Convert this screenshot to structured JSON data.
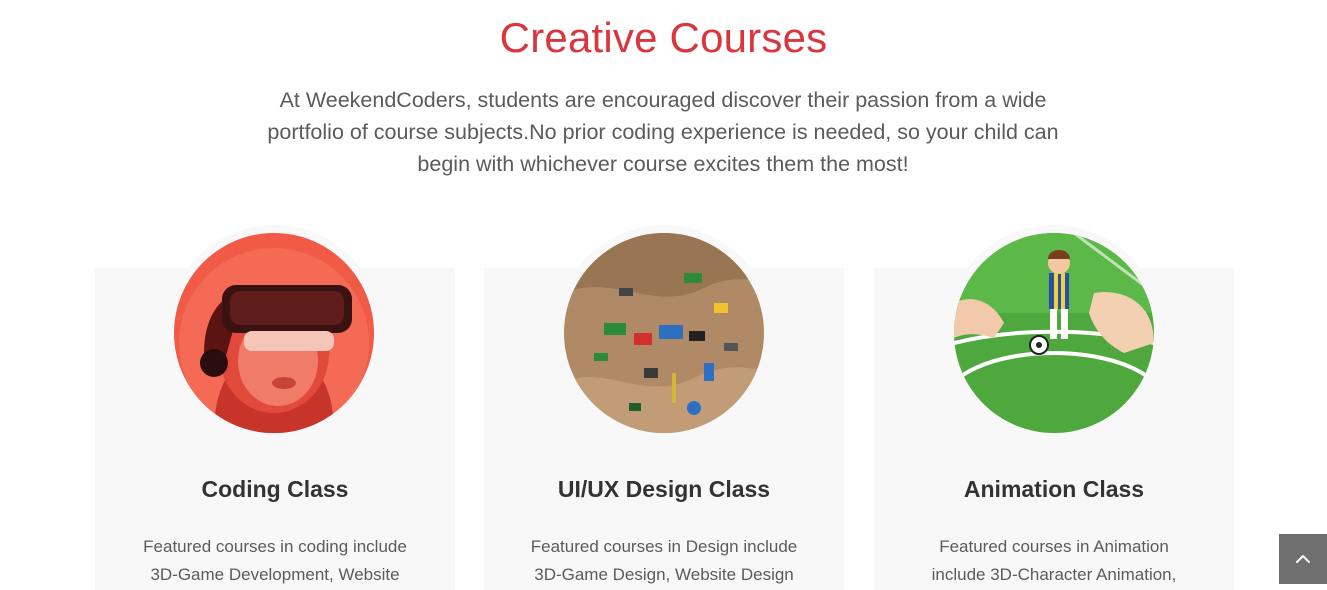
{
  "section": {
    "title": "Creative Courses",
    "intro": "At WeekendCoders, students are encouraged discover their passion from a wide portfolio of course subjects.No prior coding experience is needed, so your child can begin with whichever course excites them the most!"
  },
  "courses": [
    {
      "title": "Coding Class",
      "text": "Featured courses in coding include 3D-Game Development, Website",
      "image": "vr-headset-photo"
    },
    {
      "title": "UI/UX Design Class",
      "text": "Featured courses in Design include 3D-Game Design, Website Design",
      "image": "lego-pieces-photo"
    },
    {
      "title": "Animation Class",
      "text": "Featured courses in Animation include 3D-Character Animation,",
      "image": "football-figure-photo"
    }
  ],
  "scroll_top": {
    "icon": "chevron-up-icon"
  },
  "colors": {
    "accent": "#d9363e",
    "card_bg": "#f8f8f8",
    "body_text": "#5b5b5b",
    "scroll_button": "#6f6f6f"
  }
}
